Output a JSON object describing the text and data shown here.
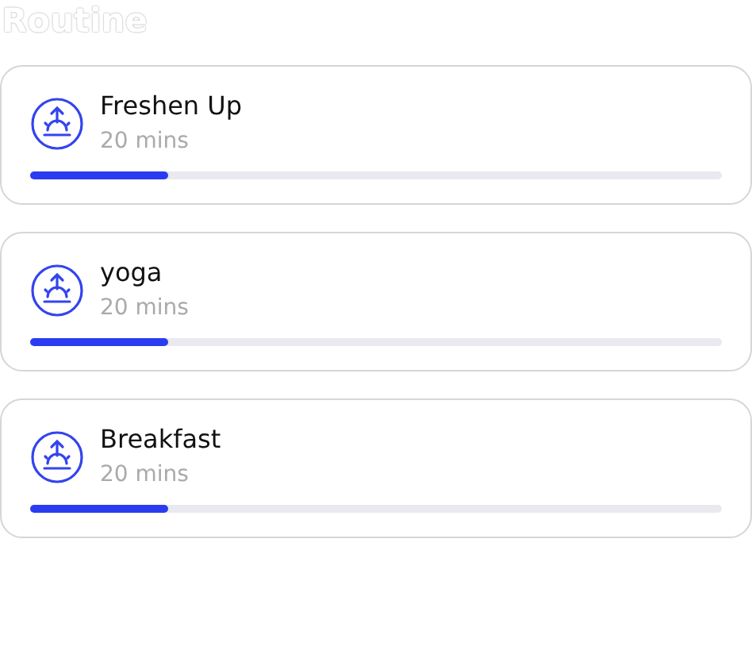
{
  "title": "Routine",
  "items": [
    {
      "name": "Freshen Up",
      "duration": "20 mins",
      "level": 0.2
    },
    {
      "name": "yoga",
      "duration": "20 mins",
      "level": 0.2
    },
    {
      "name": "Breakfast",
      "duration": "20 mins",
      "level": 0.2
    }
  ]
}
